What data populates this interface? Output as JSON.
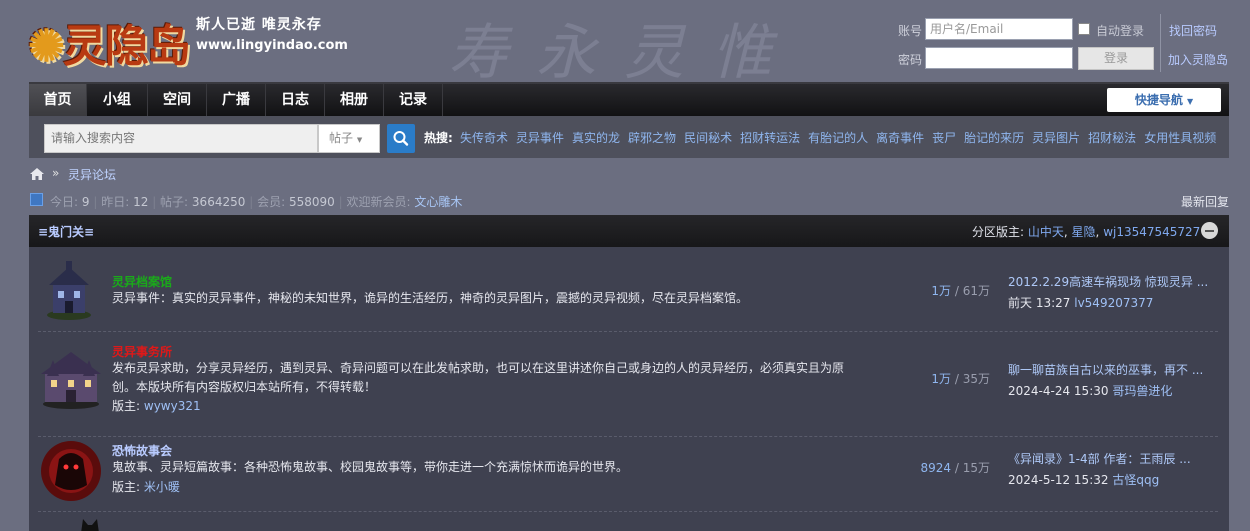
{
  "site": {
    "logo_text": "灵隐岛",
    "slogan": "斯人已逝 唯灵永存",
    "url": "www.lingyindao.com",
    "calligraphy": "寿永灵惟"
  },
  "login": {
    "account_label": "账号",
    "account_placeholder": "用户名/Email",
    "password_label": "密码",
    "auto_login_label": "自动登录",
    "login_button": "登录",
    "find_password": "找回密码",
    "join": "加入灵隐岛"
  },
  "nav": {
    "items": [
      "首页",
      "小组",
      "空间",
      "广播",
      "日志",
      "相册",
      "记录"
    ],
    "quick_nav": "快捷导航"
  },
  "search": {
    "placeholder": "请输入搜索内容",
    "type": "帖子",
    "hot_label": "热搜:",
    "hot_links": [
      "失传奇术",
      "灵异事件",
      "真实的龙",
      "辟邪之物",
      "民间秘术",
      "招财转运法",
      "有胎记的人",
      "离奇事件",
      "丧尸",
      "胎记的来历",
      "灵异图片",
      "招财秘法",
      "女用性具视频"
    ]
  },
  "breadcrumb": {
    "separator": "»",
    "forum": "灵异论坛"
  },
  "stats": {
    "today_label": "今日:",
    "today": "9",
    "yesterday_label": "昨日:",
    "yesterday": "12",
    "posts_label": "帖子:",
    "posts": "3664250",
    "members_label": "会员:",
    "members": "558090",
    "welcome_label": "欢迎新会员:",
    "new_member": "文心雕木",
    "latest_reply": "最新回复"
  },
  "section": {
    "title": "≡鬼门关≡",
    "moderators_label": "分区版主:",
    "moderators": [
      "山中天",
      "星隐",
      "wj13547545727"
    ]
  },
  "forums": [
    {
      "name": "灵异档案馆",
      "name_color": "#1aaa1a",
      "desc": "灵异事件：真实的灵异事件，神秘的未知世界，诡异的生活经历，神奇的灵异图片，震撼的灵异视频，尽在灵异档案馆。",
      "moderator_label": "",
      "moderator": "",
      "threads": "1万",
      "posts": "61万",
      "last_title": "2012.2.29高速车祸现场 惊现灵异 ...",
      "last_time": "前天 13:27",
      "last_user": "lv549207377",
      "icon": "haunted-house-icon"
    },
    {
      "name": "灵异事务所",
      "name_color": "#e01818",
      "desc": "发布灵异求助，分享灵异经历，遇到灵异、奇异问题可以在此发帖求助，也可以在这里讲述你自己或身边的人的灵异经历，必须真实且为原创。本版块所有内容版权归本站所有，不得转载！",
      "moderator_label": "版主:",
      "moderator": "wywy321",
      "threads": "1万",
      "posts": "35万",
      "last_title": "聊一聊苗族自古以来的巫事，再不 ...",
      "last_time": "2024-4-24 15:30",
      "last_user": "哥玛兽进化",
      "icon": "haunted-mansion-icon"
    },
    {
      "name": "恐怖故事会",
      "name_color": "#b9cbff",
      "desc": "鬼故事、灵异短篇故事：各种恐怖鬼故事、校园鬼故事等，带你走进一个充满惊怵而诡异的世界。",
      "moderator_label": "版主:",
      "moderator": "米小暖",
      "threads": "8924",
      "posts": "15万",
      "last_title": "《异闻录》1-4部 作者：王雨辰 ...",
      "last_time": "2024-5-12 15:32",
      "last_user": "古怪qqg",
      "icon": "red-demon-icon"
    }
  ]
}
